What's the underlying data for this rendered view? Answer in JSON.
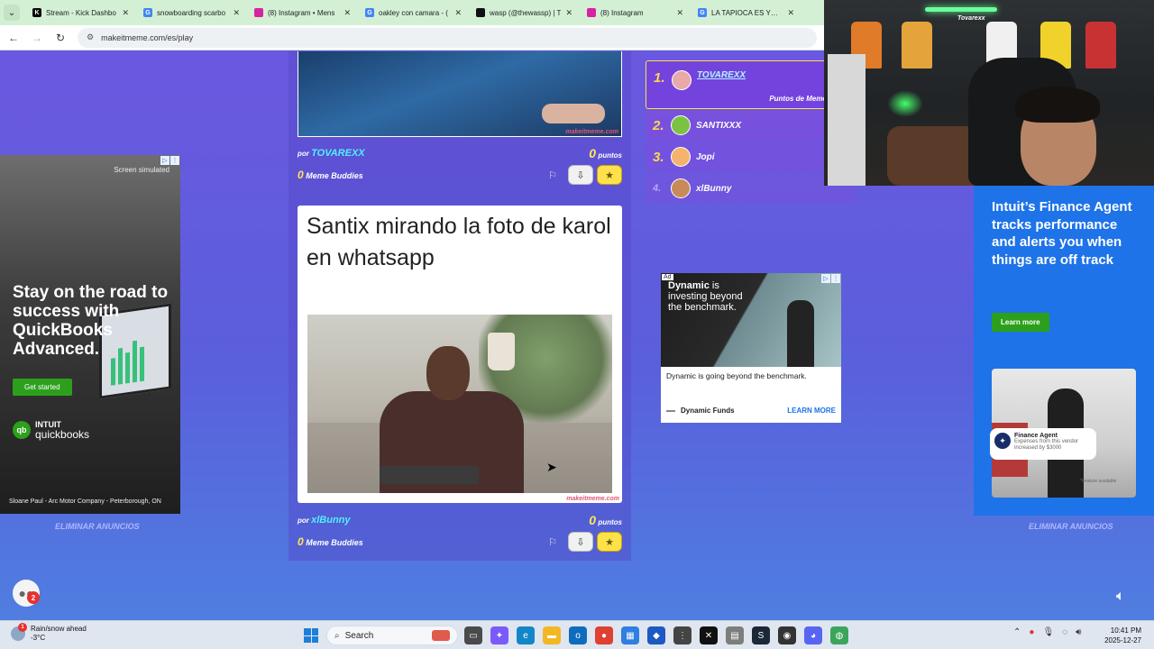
{
  "browser": {
    "tabs": [
      {
        "title": "Stream - Kick Dashbo",
        "favicon_color": "#0b0b0b",
        "favicon_text": "K",
        "active": false
      },
      {
        "title": "snowboarding scarbo",
        "favicon_color": "#4285f4",
        "favicon_text": "G",
        "active": false
      },
      {
        "title": "(8) Instagram • Mens",
        "favicon_color": "#d6249f",
        "favicon_text": "",
        "active": false
      },
      {
        "title": "oakley con camara - (",
        "favicon_color": "#4285f4",
        "favicon_text": "G",
        "active": false
      },
      {
        "title": "wasp (@thewassp) | T",
        "favicon_color": "#111111",
        "favicon_text": "",
        "active": false
      },
      {
        "title": "(8) Instagram",
        "favicon_color": "#d6249f",
        "favicon_text": "",
        "active": false
      },
      {
        "title": "LA TAPIOCA ES YUCA",
        "favicon_color": "#4285f4",
        "favicon_text": "G",
        "active": false
      }
    ],
    "url": "makeitmeme.com/es/play"
  },
  "feed": {
    "post1": {
      "by": "por",
      "author": "TOVAREXX",
      "points": "0",
      "points_label": "puntos",
      "meme_buddies_count": "0",
      "meme_buddies_label": "Meme Buddies",
      "watermark": "makeitmeme.com"
    },
    "post2": {
      "caption": "Santix mirando la foto de karol en whatsapp",
      "watermark": "makeitmeme.com",
      "by": "por",
      "author": "xlBunny",
      "points": "0",
      "points_label": "puntos",
      "meme_buddies_count": "0",
      "meme_buddies_label": "Meme Buddies"
    }
  },
  "leaderboard": {
    "entries": [
      {
        "rank": "1.",
        "name": "TOVAREXX",
        "sub": "Puntos de Meme Buddy",
        "avatar_color": "#e8a9a9"
      },
      {
        "rank": "2.",
        "name": "SANTIXXX",
        "avatar_color": "#7cc242"
      },
      {
        "rank": "3.",
        "name": "Jopi",
        "avatar_color": "#f5b36b"
      },
      {
        "rank": "4.",
        "name": "xlBunny",
        "avatar_color": "#c98a5a"
      }
    ]
  },
  "ads": {
    "left": {
      "simulated": "Screen simulated",
      "headline": "Stay on the road to success with QuickBooks Advanced.",
      "cta": "Get started",
      "brand_top": "INTUIT",
      "brand_bottom": "quickbooks",
      "caption": "Sloane Paul - Arc Motor Company - Peterborough, ON"
    },
    "mid": {
      "ad_tag": "Ad",
      "brand": "Dynamic",
      "headline_rest": "is investing beyond the benchmark.",
      "description": "Dynamic is going beyond the benchmark.",
      "advertiser": "Dynamic Funds",
      "cta": "LEARN MORE"
    },
    "right": {
      "headline": "Intuit’s Finance Agent tracks performance and alerts you when things are off track",
      "cta": "Learn more",
      "card_title": "Finance Agent",
      "card_sub": "Expenses from this vendor increased by $3000",
      "fine_print": "*Feature available"
    },
    "remove_label": "ELIMINAR ANUNCIOS"
  },
  "webcam": {
    "overlay_name": "Tovarexx"
  },
  "chat": {
    "badge": "2"
  },
  "taskbar": {
    "weather_title": "Rain/snow ahead",
    "weather_temp": "-3°C",
    "weather_badge": "1",
    "search_placeholder": "Search",
    "time": "10:41 PM",
    "date": "2025-12-27",
    "apps": [
      {
        "name": "task-view",
        "color": "#4a4a4a",
        "glyph": "▭"
      },
      {
        "name": "copilot",
        "color": "#7a5af8",
        "glyph": "✦"
      },
      {
        "name": "edge",
        "color": "#1386c9",
        "glyph": "e"
      },
      {
        "name": "file-explorer",
        "color": "#f2b824",
        "glyph": "▬"
      },
      {
        "name": "outlook",
        "color": "#0f6cbd",
        "glyph": "o"
      },
      {
        "name": "chrome",
        "color": "#de4032",
        "glyph": "●"
      },
      {
        "name": "store",
        "color": "#2d7fe0",
        "glyph": "▦"
      },
      {
        "name": "app-dots",
        "color": "#1e58c2",
        "glyph": "◆"
      },
      {
        "name": "grid",
        "color": "#444444",
        "glyph": "⋮"
      },
      {
        "name": "capcut",
        "color": "#111111",
        "glyph": "✕"
      },
      {
        "name": "notes",
        "color": "#7d7d7d",
        "glyph": "▤"
      },
      {
        "name": "steam",
        "color": "#1b2838",
        "glyph": "S"
      },
      {
        "name": "obs",
        "color": "#333333",
        "glyph": "◉"
      },
      {
        "name": "discord",
        "color": "#5865f2",
        "glyph": "◕"
      },
      {
        "name": "globe",
        "color": "#3ba55c",
        "glyph": "◍"
      }
    ]
  }
}
